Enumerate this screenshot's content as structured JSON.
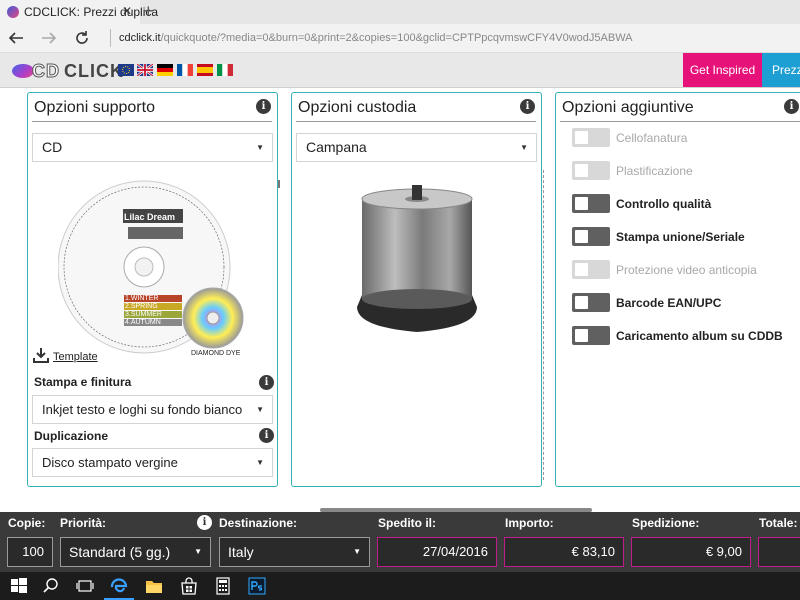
{
  "browser": {
    "tab_title": "CDCLICK: Prezzi duplica",
    "tab_close": "✕",
    "new_tab": "+",
    "url_host": "cdclick.it",
    "url_path": "/quickquote/?media=0&burn=0&print=2&copies=100&gclid=CPTPpcqvmswCFY4V0wodJ5ABWA"
  },
  "header": {
    "logo_cd": "CD",
    "logo_click": "CLICK",
    "flags": [
      "eu",
      "uk",
      "de",
      "fr",
      "es",
      "it"
    ],
    "inspire_label": "Get Inspired",
    "prices_label": "Prezzi"
  },
  "support": {
    "title": "Opzioni supporto",
    "media_value": "CD",
    "disc_title": "Lilac Dream",
    "disc_tracks": [
      "1.WINTER",
      "2.SPRING",
      "3.SUMMER",
      "4.AUTUMN"
    ],
    "diamond_label": "DIAMOND DYE",
    "template_label": "Template",
    "print_label": "Stampa e finitura",
    "print_value": "Inkjet testo e loghi su fondo bianco",
    "dup_label": "Duplicazione",
    "dup_value": "Disco stampato vergine"
  },
  "case": {
    "title": "Opzioni custodia",
    "value": "Campana"
  },
  "extras": {
    "title": "Opzioni aggiuntive",
    "options": [
      {
        "label": "Cellofanatura",
        "enabled": false
      },
      {
        "label": "Plastificazione",
        "enabled": false
      },
      {
        "label": "Controllo qualità",
        "enabled": true
      },
      {
        "label": "Stampa unione/Seriale",
        "enabled": true
      },
      {
        "label": "Protezione video anticopia",
        "enabled": false
      },
      {
        "label": "Barcode EAN/UPC",
        "enabled": true
      },
      {
        "label": "Caricamento album su CDDB",
        "enabled": true
      }
    ]
  },
  "footer": {
    "copies_label": "Copie:",
    "copies_value": "100",
    "priority_label": "Priorità:",
    "priority_value": "Standard (5 gg.)",
    "dest_label": "Destinazione:",
    "dest_value": "Italy",
    "shipped_label": "Spedito il:",
    "shipped_value": "27/04/2016",
    "amount_label": "Importo:",
    "amount_value": "€ 83,10",
    "shipping_label": "Spedizione:",
    "shipping_value": "€ 9,00",
    "total_label": "Totale:"
  },
  "colors": {
    "accent_teal": "#35b0b4",
    "inspire_pink": "#e6127a",
    "prices_blue": "#1e9fd3",
    "field_border_pink": "#c21c8a"
  }
}
